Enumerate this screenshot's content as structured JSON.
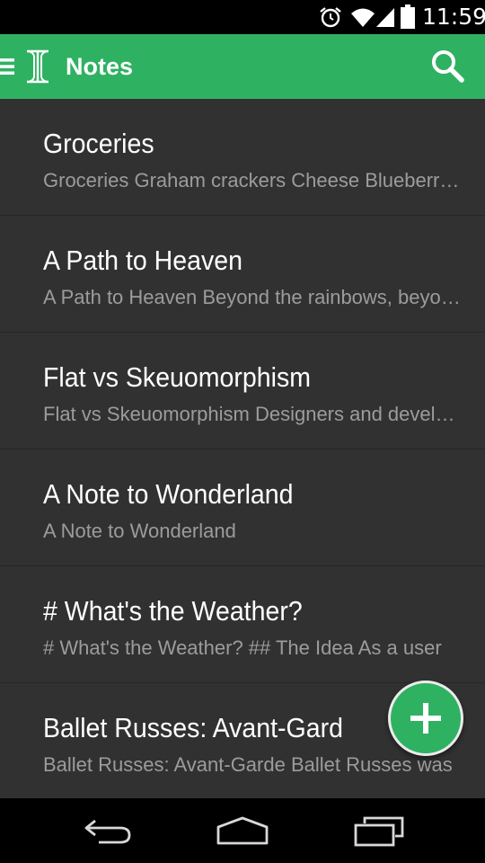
{
  "status_bar": {
    "time": "11:59",
    "icons": [
      "alarm-icon",
      "wifi-icon",
      "signal-icon",
      "battery-icon"
    ]
  },
  "action_bar": {
    "title": "Notes",
    "icons": [
      "menu-icon",
      "app-logo-icon",
      "search-icon"
    ],
    "color": "#2fb162"
  },
  "notes": [
    {
      "title": "Groceries",
      "preview": "Groceries  Graham crackers Cheese Blueberries"
    },
    {
      "title": "A Path to Heaven",
      "preview": "A Path to Heaven  Beyond the rainbows, beyond"
    },
    {
      "title": "Flat vs Skeuomorphism",
      "preview": "Flat vs Skeuomorphism  Designers and developers"
    },
    {
      "title": "A Note to Wonderland",
      "preview": "A Note to Wonderland"
    },
    {
      "title": "# What's the Weather?",
      "preview": "# What's the Weather?  ## The Idea  As a user"
    },
    {
      "title": "Ballet Russes: Avant-Gard",
      "preview": "Ballet Russes: Avant-Garde  Ballet Russes was"
    }
  ],
  "fab": {
    "icon": "plus-icon",
    "color": "#2fb162"
  },
  "nav_bar": {
    "icons": [
      "back-icon",
      "home-icon",
      "recents-icon"
    ]
  },
  "colors": {
    "background": "#2f2f2f",
    "title_text": "#ffffff",
    "preview_text": "#9c9c9c"
  }
}
